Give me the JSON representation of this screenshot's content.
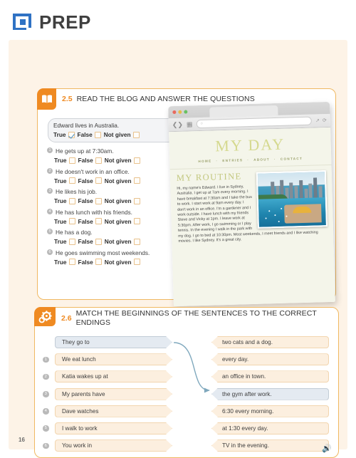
{
  "brand": {
    "title": "PREP",
    "logo_icon": "prep-logo-icon"
  },
  "page": {
    "number": "16",
    "background_color": "#fdf3e7",
    "accent_color": "#ef8a22"
  },
  "exercise_25": {
    "number": "2.5",
    "title": "READ THE BLOG AND ANSWER THE QUESTIONS",
    "icon": "open-book-icon",
    "options": [
      "True",
      "False",
      "Not given"
    ],
    "example": {
      "text": "Edward lives in Australia.",
      "checked_option": "True"
    },
    "questions": [
      {
        "num": "1",
        "text": "He gets up at 7:30am."
      },
      {
        "num": "2",
        "text": "He doesn't work in an office."
      },
      {
        "num": "3",
        "text": "He likes his job."
      },
      {
        "num": "4",
        "text": "He has lunch with his friends."
      },
      {
        "num": "5",
        "text": "He has a dog."
      },
      {
        "num": "6",
        "text": "He goes swimming most weekends."
      }
    ]
  },
  "browser": {
    "traffic_lights": [
      "red",
      "yellow",
      "green"
    ],
    "back_forward_icon": "back-forward-icon",
    "sidebar_icon": "sidebar-icon",
    "url_value": "",
    "search_icon": "search-icon",
    "share_icon": "share-icon",
    "reload_icon": "reload-icon",
    "blog": {
      "site_title": "MY DAY",
      "nav": [
        "HOME",
        "ENTRIES",
        "ABOUT",
        "CONTACT"
      ],
      "post_title": "MY ROUTINE",
      "photo_alt": "sydney-harbour-photo",
      "body": "Hi, my name's Edward. I live in Sydney, Australia. I get up at 7am every morning. I have breakfast at 7:30am and I take the bus to work. I start work at 9am every day. I don't work in an office. I'm a gardener and I work outside. I have lunch with my friends Steve and Vicky at 1pm. I leave work at 5:30pm. After work, I go swimming or I play tennis. In the evening I walk in the park with my dog. I go to bed at 10:30pm. Most weekends, I meet friends and I like watching movies. I like Sydney. It's a great city."
    }
  },
  "exercise_26": {
    "number": "2.6",
    "title": "MATCH THE BEGINNINGS OF THE SENTENCES TO THE CORRECT ENDINGS",
    "icon": "gear-icon",
    "speaker_icon": "speaker-icon",
    "beginnings": [
      {
        "num": "",
        "text": "They go to",
        "selected": true
      },
      {
        "num": "1",
        "text": "We eat lunch",
        "selected": false
      },
      {
        "num": "2",
        "text": "Katia wakes up at",
        "selected": false
      },
      {
        "num": "3",
        "text": "My parents have",
        "selected": false
      },
      {
        "num": "4",
        "text": "Dave watches",
        "selected": false
      },
      {
        "num": "5",
        "text": "I walk to work",
        "selected": false
      },
      {
        "num": "6",
        "text": "You work in",
        "selected": false
      }
    ],
    "endings": [
      {
        "text": "two cats and a dog.",
        "selected": false
      },
      {
        "text": "every day.",
        "selected": false
      },
      {
        "text": "an office in town.",
        "selected": false
      },
      {
        "text": "the gym after work.",
        "selected": true
      },
      {
        "text": "6:30 every morning.",
        "selected": false
      },
      {
        "text": "at 1:30 every day.",
        "selected": false
      },
      {
        "text": "TV in the evening.",
        "selected": false
      }
    ],
    "connection": {
      "from": "They go to",
      "to": "the gym after work.",
      "color": "#7fa8bd"
    }
  }
}
